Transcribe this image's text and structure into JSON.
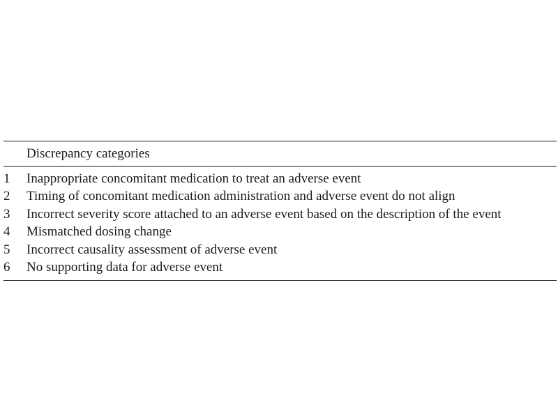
{
  "table": {
    "header": {
      "number": "",
      "category": "Discrepancy categories"
    },
    "rows": [
      {
        "number": "1",
        "category": "Inappropriate concomitant medication to treat an adverse event"
      },
      {
        "number": "2",
        "category": "Timing of concomitant medication administration and adverse event do not align"
      },
      {
        "number": "3",
        "category": "Incorrect severity score attached to an adverse event based on the description of the event"
      },
      {
        "number": "4",
        "category": "Mismatched dosing change"
      },
      {
        "number": "5",
        "category": "Incorrect causality assessment of adverse event"
      },
      {
        "number": "6",
        "category": "No supporting data for adverse event"
      }
    ]
  }
}
